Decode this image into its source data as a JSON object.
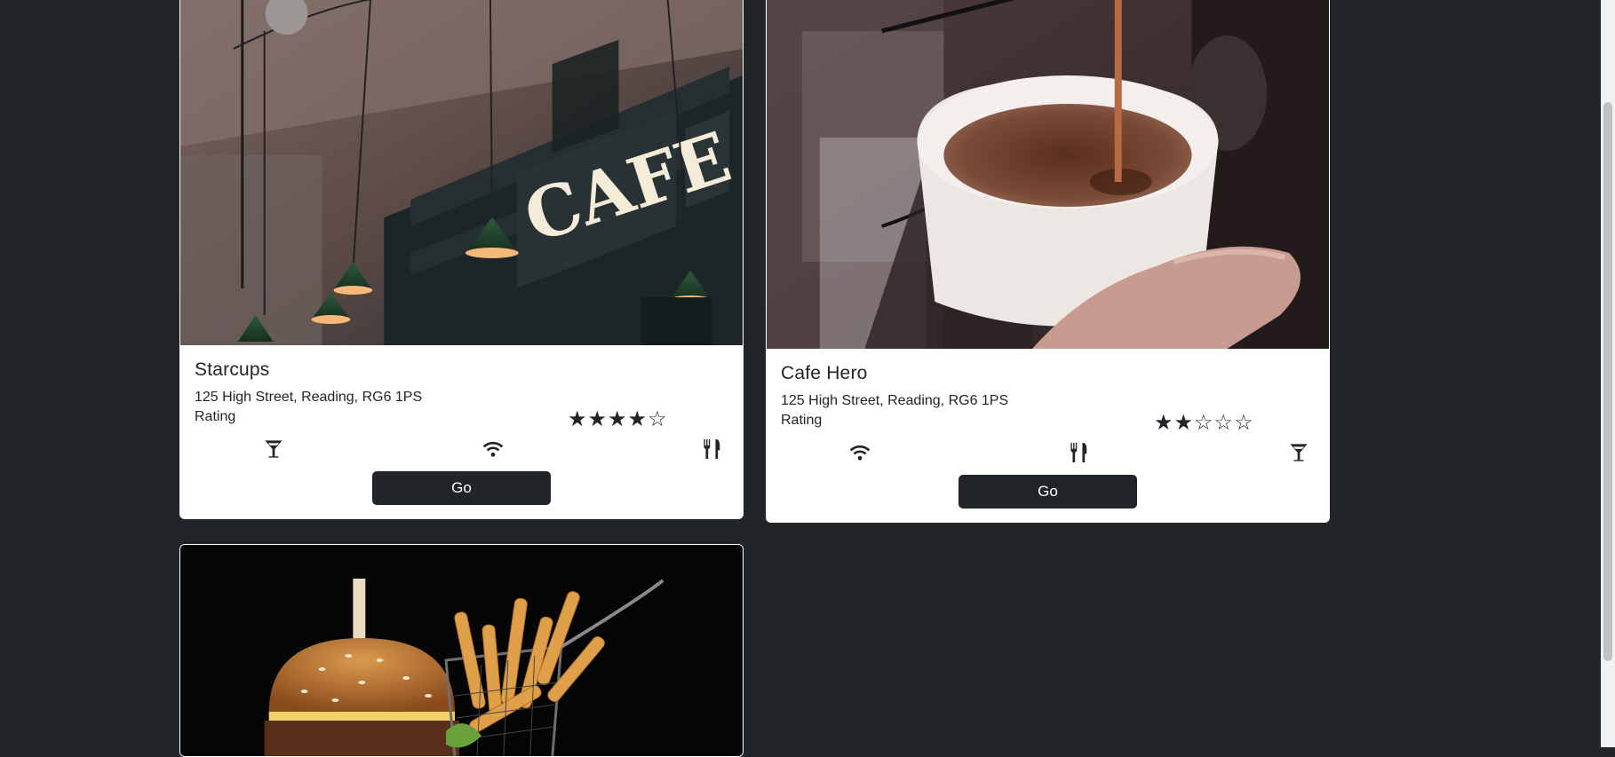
{
  "cards": [
    {
      "title": "Starcups",
      "address": "125 High Street, Reading, RG6 1PS",
      "rating_label": "Rating",
      "rating": 4,
      "rating_max": 5,
      "stars_text": "★★★★☆",
      "image": "cafe-interior-neon-sign",
      "amenities": [
        "cocktail-icon",
        "wifi-icon",
        "restaurant-icon"
      ],
      "button_label": "Go"
    },
    {
      "title": "Cafe Hero",
      "address": "125 High Street, Reading, RG6 1PS",
      "rating_label": "Rating",
      "rating": 2,
      "rating_max": 5,
      "stars_text": "★★☆☆☆",
      "image": "coffee-pouring-into-cup",
      "amenities": [
        "wifi-icon",
        "restaurant-icon",
        "cocktail-icon"
      ],
      "button_label": "Go"
    },
    {
      "image": "burger-and-fries"
    }
  ],
  "colors": {
    "page_bg": "#212529",
    "card_bg": "#ffffff",
    "button_bg": "#212529",
    "button_text": "#ffffff"
  }
}
